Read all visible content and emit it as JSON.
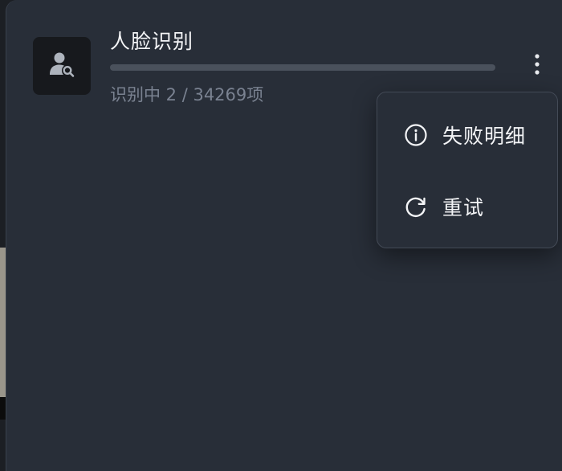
{
  "task": {
    "title": "人脸识别",
    "status_text": "识别中 2 / 34269项",
    "progress_fraction": 0.0001,
    "icon": "face-search-icon"
  },
  "more_menu": {
    "icon": "more-vertical-icon",
    "items": [
      {
        "label": "失败明细",
        "icon": "info-icon"
      },
      {
        "label": "重试",
        "icon": "refresh-icon"
      }
    ]
  },
  "colors": {
    "panel_bg": "#282e38",
    "text_primary": "#f3f4f6",
    "text_secondary": "#7a8291",
    "progress_track": "#4a515c"
  }
}
